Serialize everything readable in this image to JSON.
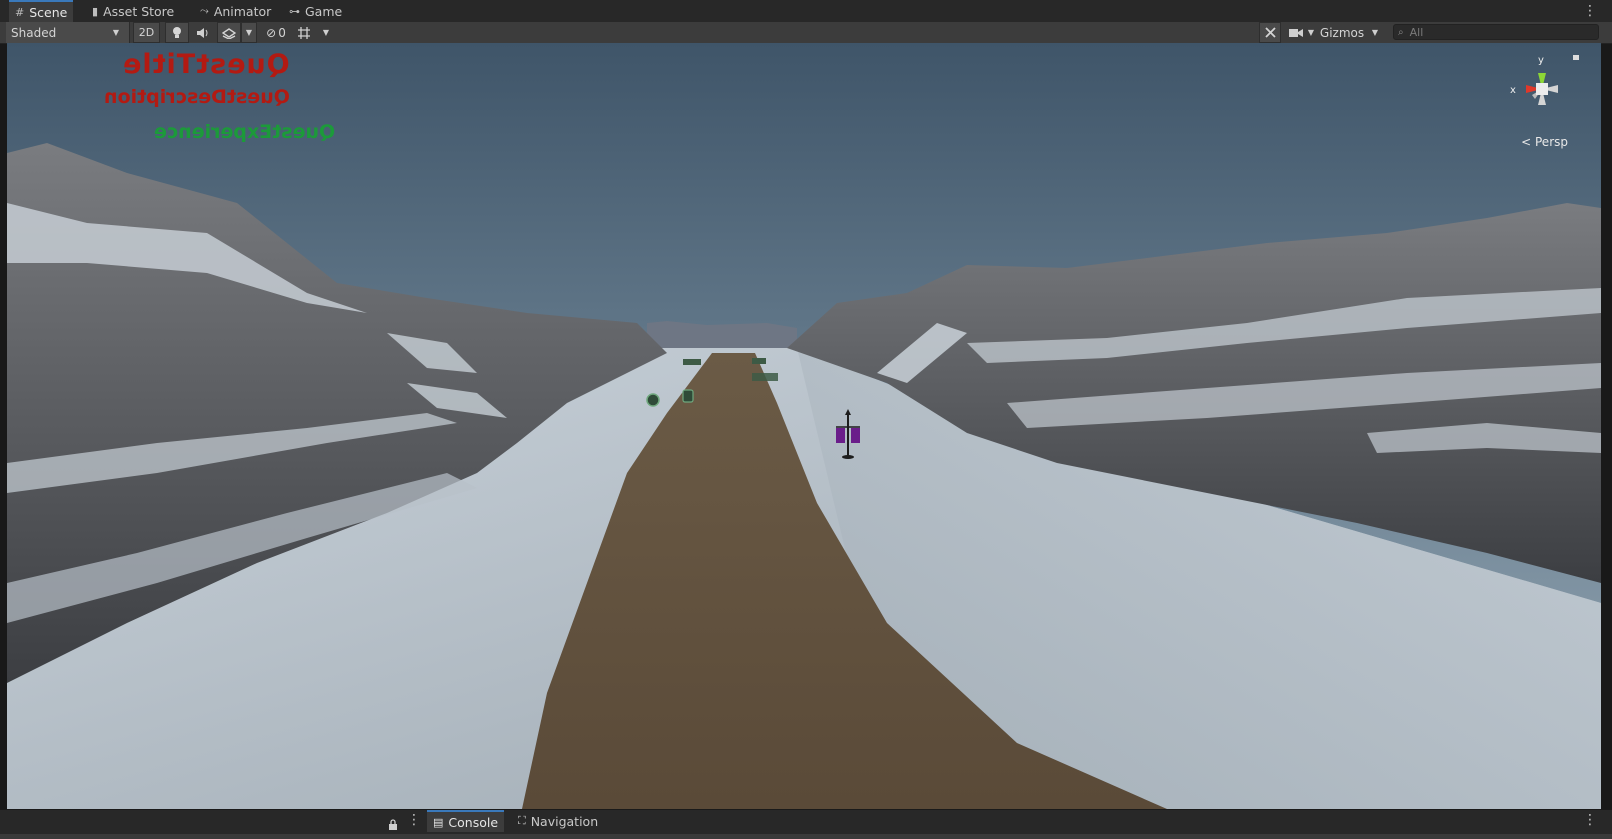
{
  "window_tabs": [
    {
      "icon": "grid-icon",
      "glyph": "#",
      "label": "Scene",
      "active": true
    },
    {
      "icon": "bag-icon",
      "glyph": "▮",
      "label": "Asset Store",
      "active": false
    },
    {
      "icon": "animator-icon",
      "glyph": "⤳",
      "label": "Animator",
      "active": false
    },
    {
      "icon": "gamepad-icon",
      "glyph": "⊶",
      "label": "Game",
      "active": false
    }
  ],
  "toolbar": {
    "shading_mode": "Shaded",
    "mode_2d": "2D",
    "hidden_count": "0",
    "gizmos_label": "Gizmos",
    "search_placeholder": "All"
  },
  "scene_overlay": {
    "quest_title": "QuestTitle",
    "quest_description": "QuestDescription",
    "quest_experience": "QuestExperience"
  },
  "orientation_gizmo": {
    "x_label": "x",
    "y_label": "y",
    "projection_label": "Persp",
    "projection_glyph": "<"
  },
  "bottom_tabs": [
    {
      "icon": "console-icon",
      "glyph": "▤",
      "label": "Console",
      "active": true
    },
    {
      "icon": "navigation-icon",
      "glyph": "⛶",
      "label": "Navigation",
      "active": false
    }
  ],
  "colors": {
    "quest_title": "#b31a12",
    "quest_description": "#b31a12",
    "quest_experience": "#1c9a3a",
    "gizmo_x": "#e0382a",
    "gizmo_y": "#8cd636",
    "active_tab_accent": "#3a79bb"
  }
}
